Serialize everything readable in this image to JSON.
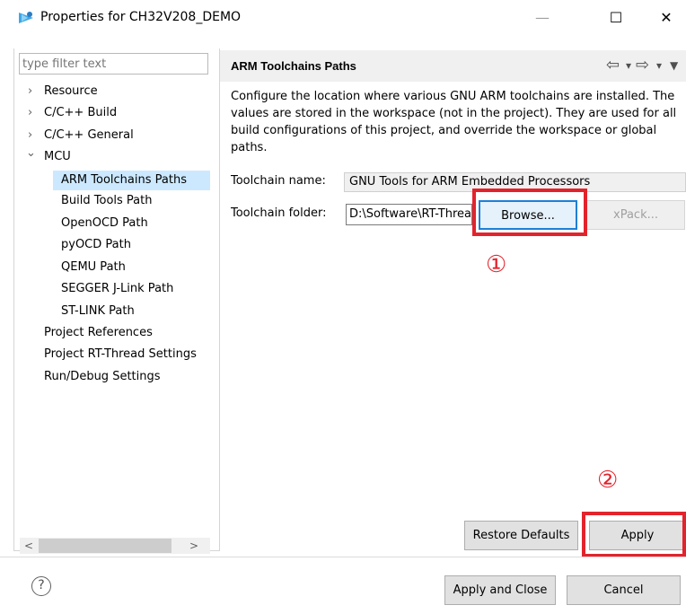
{
  "window": {
    "title": "Properties for CH32V208_DEMO",
    "minimize": "—",
    "maximize": "☐",
    "close": "✕"
  },
  "filter": {
    "placeholder": "type filter text"
  },
  "tree": {
    "items": [
      {
        "label": "Resource",
        "arrow": "›"
      },
      {
        "label": "C/C++ Build",
        "arrow": "›"
      },
      {
        "label": "C/C++ General",
        "arrow": "›"
      },
      {
        "label": "MCU",
        "arrow": "⌄"
      },
      {
        "label": "ARM Toolchains Paths"
      },
      {
        "label": "Build Tools Path"
      },
      {
        "label": "OpenOCD Path"
      },
      {
        "label": "pyOCD Path"
      },
      {
        "label": "QEMU Path"
      },
      {
        "label": "SEGGER J-Link Path"
      },
      {
        "label": "ST-LINK Path"
      },
      {
        "label": "Project References"
      },
      {
        "label": "Project RT-Thread Settings"
      },
      {
        "label": "Run/Debug Settings"
      }
    ],
    "scroll_left": "<",
    "scroll_right": ">"
  },
  "page": {
    "title": "ARM Toolchains Paths",
    "nav_back": "⇦",
    "nav_forward": "⇨",
    "nav_dropdown": "▾",
    "nav_menu": "▼",
    "description": "Configure the location where various GNU ARM toolchains are installed. The values are stored in the workspace (not in the project). They are used for all build configurations of this project, and override the workspace or global paths.",
    "toolchain_name_label": "Toolchain name:",
    "toolchain_name_value": "GNU Tools for ARM Embedded Processors",
    "toolchain_folder_label": "Toolchain folder:",
    "toolchain_folder_value": "D:\\Software\\RT-Thread",
    "browse_label": "Browse...",
    "xpack_label": "xPack...",
    "restore_label": "Restore Defaults",
    "apply_label": "Apply"
  },
  "annotations": {
    "mark1": "①",
    "mark2": "②"
  },
  "footer": {
    "help": "?",
    "apply_close_label": "Apply and Close",
    "cancel_label": "Cancel"
  }
}
